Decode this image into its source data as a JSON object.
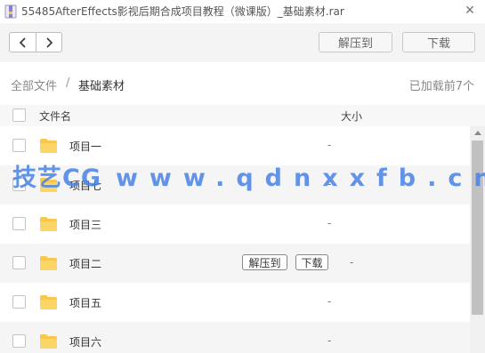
{
  "window": {
    "title": "55485AfterEffects影视后期合成项目教程（微课版）_基础素材.rar",
    "close_glyph": "✕",
    "icon": "archive-file-icon"
  },
  "toolbar": {
    "back_icon": "chevron-left-icon",
    "forward_icon": "chevron-right-icon",
    "extract_label": "解压到",
    "download_label": "下载"
  },
  "breadcrumb": {
    "root": "全部文件",
    "separator": "/",
    "current": "基础素材",
    "loaded": "已加载前7个"
  },
  "table": {
    "col_name": "文件名",
    "col_size": "大小"
  },
  "rows": [
    {
      "name": "项目一",
      "size": "-",
      "icon": "folder-icon"
    },
    {
      "name": "项目七",
      "size": "-",
      "icon": "folder-icon"
    },
    {
      "name": "项目三",
      "size": "-",
      "icon": "folder-icon"
    },
    {
      "name": "项目二",
      "size": "-",
      "icon": "folder-icon",
      "hovered": true,
      "extract_label": "解压到",
      "download_label": "下载"
    },
    {
      "name": "项目五",
      "size": "-",
      "icon": "folder-icon"
    },
    {
      "name": "项目六",
      "size": "-",
      "icon": "folder-icon"
    }
  ],
  "watermark": {
    "brand": "技艺CG",
    "url": "www.qdnxxfb.cn"
  },
  "colors": {
    "folder": "#f9c84a",
    "watermark": "#4682e6",
    "toolbar_bg": "#f4f4f4"
  }
}
